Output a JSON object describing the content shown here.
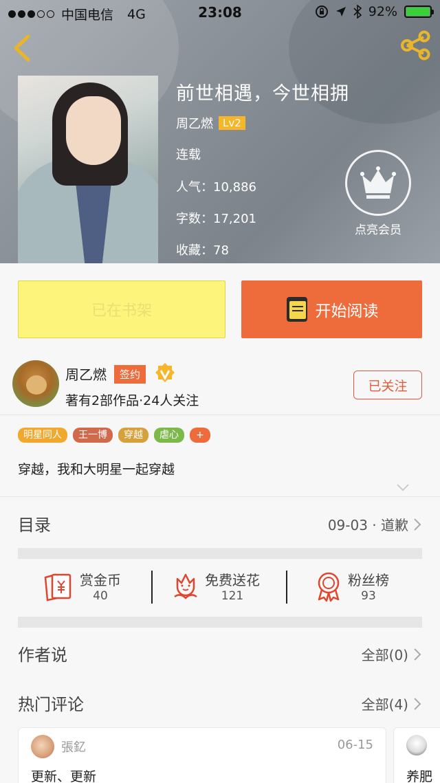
{
  "status_bar": {
    "carrier": "中国电信",
    "network": "4G",
    "time": "23:08",
    "battery": "92%"
  },
  "book": {
    "title": "前世相遇，今世相拥",
    "author": "周乙燃",
    "level": "Lv2",
    "status": "连载",
    "popularity_label": "人气：",
    "popularity": "10,886",
    "words_label": "字数：",
    "words": "17,201",
    "favorites_label": "收藏：",
    "favorites": "78"
  },
  "vip": {
    "label": "点亮会员"
  },
  "actions": {
    "shelf_label": "已在书架",
    "read_label": "开始阅读"
  },
  "author_card": {
    "name": "周乙燃",
    "badge": "签约",
    "subtitle": "著有2部作品·24人关注",
    "follow_label": "已关注"
  },
  "tags": [
    {
      "label": "明星同人",
      "color": "#f0a92e"
    },
    {
      "label": "王一博",
      "color": "#d06a4c"
    },
    {
      "label": "穿越",
      "color": "#d6a03a"
    },
    {
      "label": "虐心",
      "color": "#7cb84a"
    },
    {
      "label": "+",
      "color": "#ee6b3c"
    }
  ],
  "intro": "穿越，我和大明星一起穿越",
  "catalog": {
    "title": "目录",
    "latest": "09-03 · 道歉"
  },
  "stats": [
    {
      "label": "赏金币",
      "value": "40"
    },
    {
      "label": "免费送花",
      "value": "121"
    },
    {
      "label": "粉丝榜",
      "value": "93"
    }
  ],
  "author_says": {
    "title": "作者说",
    "all": "全部(0)"
  },
  "hot_comments": {
    "title": "热门评论",
    "all": "全部(4)"
  },
  "comments": [
    {
      "user": "張釔",
      "date": "06-15",
      "text": "更新、更新"
    },
    {
      "text": "养肥"
    }
  ],
  "colors": {
    "accent": "#ee6b3c",
    "shelf": "#fcf47b",
    "icon_red": "#e0452e",
    "back_yellow": "#e9b52a"
  }
}
